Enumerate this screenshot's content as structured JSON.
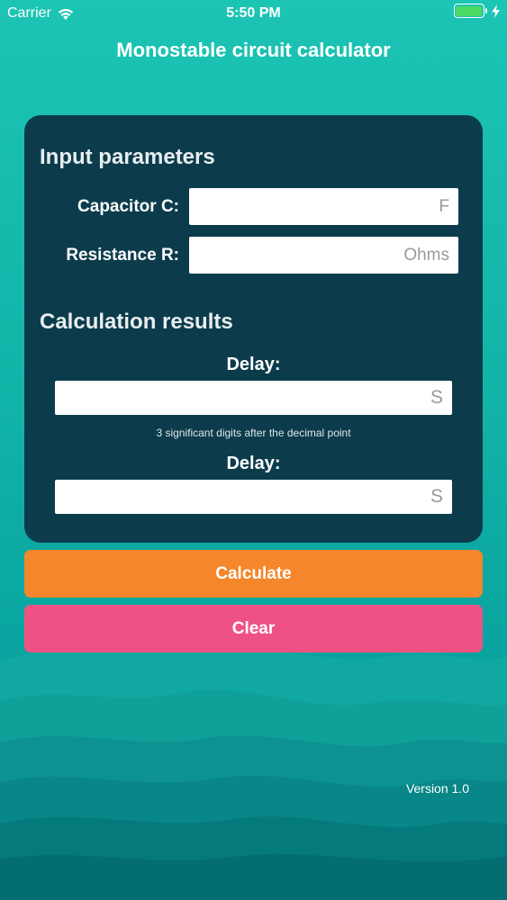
{
  "status_bar": {
    "carrier": "Carrier",
    "time": "5:50 PM",
    "signal_icon": "wifi-icon",
    "battery_icon": "battery-icon",
    "charging_icon": "charging-bolt-icon"
  },
  "app": {
    "title": "Monostable circuit calculator"
  },
  "input_section": {
    "title": "Input parameters",
    "capacitor": {
      "label": "Capacitor C:",
      "value": "",
      "placeholder": "F"
    },
    "resistance": {
      "label": "Resistance R:",
      "value": "",
      "placeholder": "Ohms"
    }
  },
  "results_section": {
    "title": "Calculation results",
    "delay_1": {
      "label": "Delay:",
      "value": "",
      "placeholder": "S"
    },
    "hint": "3 significant digits after the decimal point",
    "delay_2": {
      "label": "Delay:",
      "value": "",
      "placeholder": "S"
    }
  },
  "buttons": {
    "calculate": "Calculate",
    "clear": "Clear"
  },
  "footer": {
    "version": "Version 1.0"
  },
  "colors": {
    "background_top": "#1cc4b4",
    "panel": "#0c3c4c",
    "calculate_button": "#f5862b",
    "clear_button": "#ee5284",
    "battery_fill": "#4cd964"
  }
}
